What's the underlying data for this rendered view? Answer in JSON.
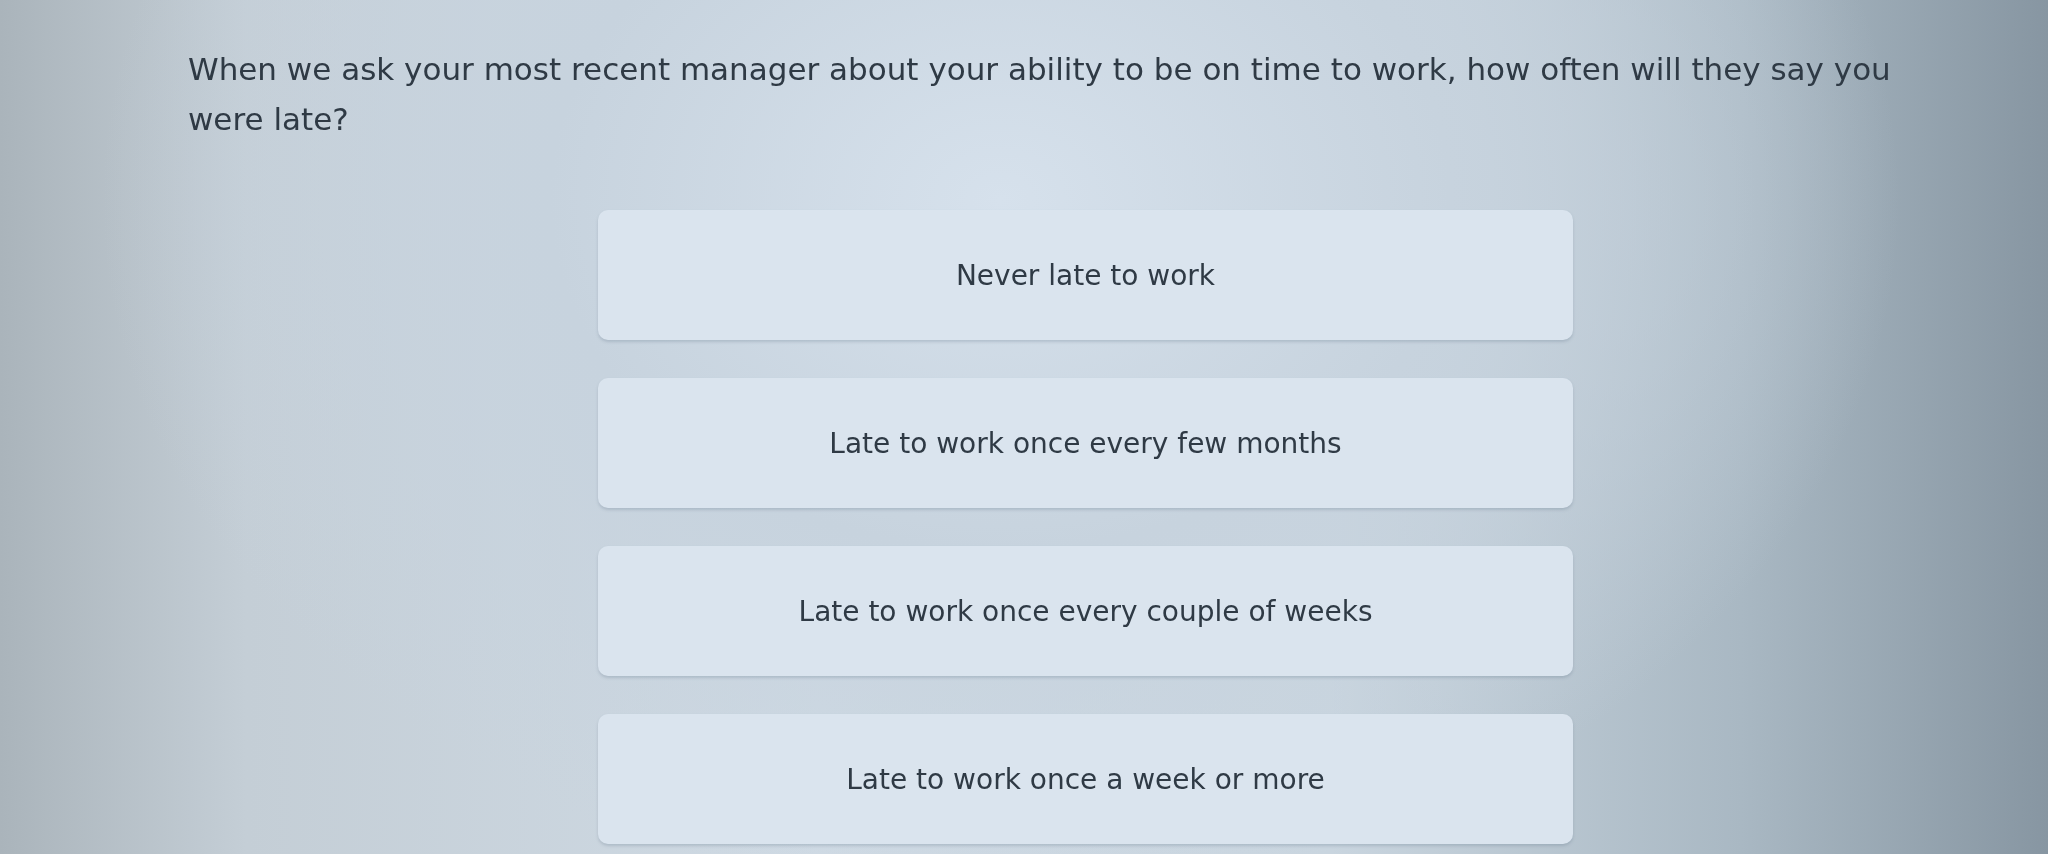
{
  "question": {
    "text": "When we ask your most recent manager about your ability to be on time to work, how often will they say you were late?"
  },
  "options": [
    {
      "label": "Never late to work",
      "selected": false
    },
    {
      "label": "Late to work once every few months",
      "selected": false
    },
    {
      "label": "Late to work once every couple of weeks",
      "selected": false
    },
    {
      "label": "Late to work once a week or more",
      "selected": false
    }
  ]
}
